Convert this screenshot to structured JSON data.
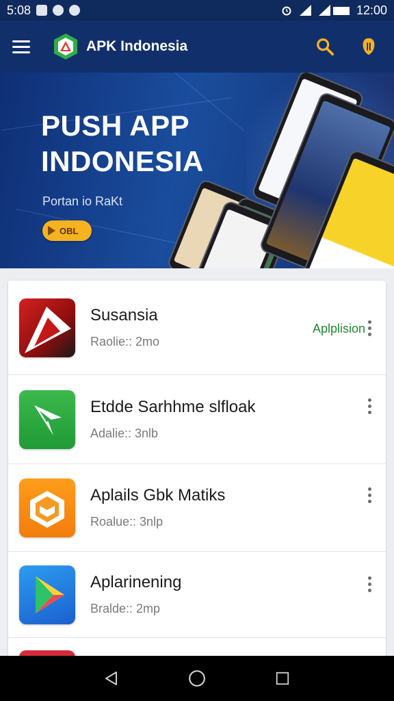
{
  "status_bar": {
    "time_left": "5:08",
    "time_right": "12:00"
  },
  "app_bar": {
    "title": "APK Indonesia",
    "menu_icon": "hamburger-menu-icon",
    "search_icon": "search-icon",
    "extra_icon": "badge-icon"
  },
  "banner": {
    "title_line1": "PUSH APP",
    "title_line2": "INDONESIA",
    "subtitle": "Portan io RaKt",
    "button_label": "OBL"
  },
  "apps": [
    {
      "name": "Susansia",
      "meta": "Raolie:: 2mo",
      "tag": "Aplplision",
      "icon": "red-play-icon"
    },
    {
      "name": "Etdde Sarhhme slfloak",
      "meta": "Adalie:: 3nlb",
      "tag": "",
      "icon": "green-arrow-icon"
    },
    {
      "name": "Aplails Gbk Matiks",
      "meta": "Roalue:: 3nlp",
      "tag": "",
      "icon": "orange-cube-icon"
    },
    {
      "name": "Aplarinening",
      "meta": "Bralde:: 2mp",
      "tag": "",
      "icon": "play-store-icon"
    }
  ],
  "colors": {
    "app_bar": "#11306b",
    "accent_yellow": "#f6b221",
    "tag_green": "#1f8a34"
  }
}
